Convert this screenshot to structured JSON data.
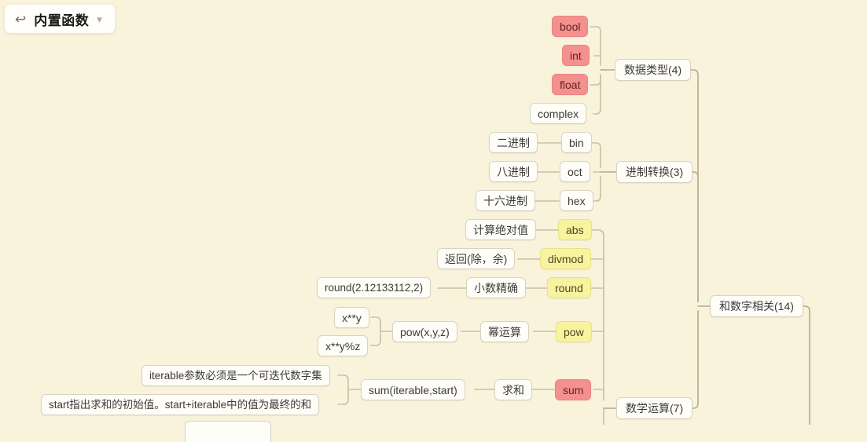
{
  "header": {
    "back_icon": "back-arrow-icon",
    "title": "内置函数",
    "expand_icon": "chevron-down-icon"
  },
  "theme": {
    "background": "#faf3dc",
    "node_fill": "#fffdf7",
    "node_border": "#d8d2c2",
    "salmon": "#f4908e",
    "yellow": "#f8f39f",
    "wire": "#c9bfa6",
    "text": "#3b3b3b"
  },
  "mindmap": {
    "root_label": "内置函数",
    "nodes": {
      "bool": "bool",
      "int": "int",
      "float": "float",
      "complex": "complex",
      "datatype_branch": "数据类型(4)",
      "bin_desc": "二进制",
      "bin": "bin",
      "oct_desc": "八进制",
      "oct": "oct",
      "hex_desc": "十六进制",
      "hex": "hex",
      "radix_branch": "进制转换(3)",
      "abs_desc": "计算绝对值",
      "abs": "abs",
      "divmod_desc": "返回(除，余)",
      "divmod": "divmod",
      "round_example": "round(2.12133112,2)",
      "round_desc": "小数精确",
      "round": "round",
      "pow_arg1": "x**y",
      "pow_arg2": "x**y%z",
      "pow_signature": "pow(x,y,z)",
      "pow_desc": "幂运算",
      "pow": "pow",
      "sum_note_iterable": "iterable参数必须是一个可迭代数字集",
      "sum_note_start": "start指出求和的初始值。start+iterable中的值为最终的和",
      "sum_signature": "sum(iterable,start)",
      "sum_desc": "求和",
      "sum": "sum",
      "math_branch": "数学运算(7)",
      "number_branch": "和数字相关(14)"
    }
  }
}
